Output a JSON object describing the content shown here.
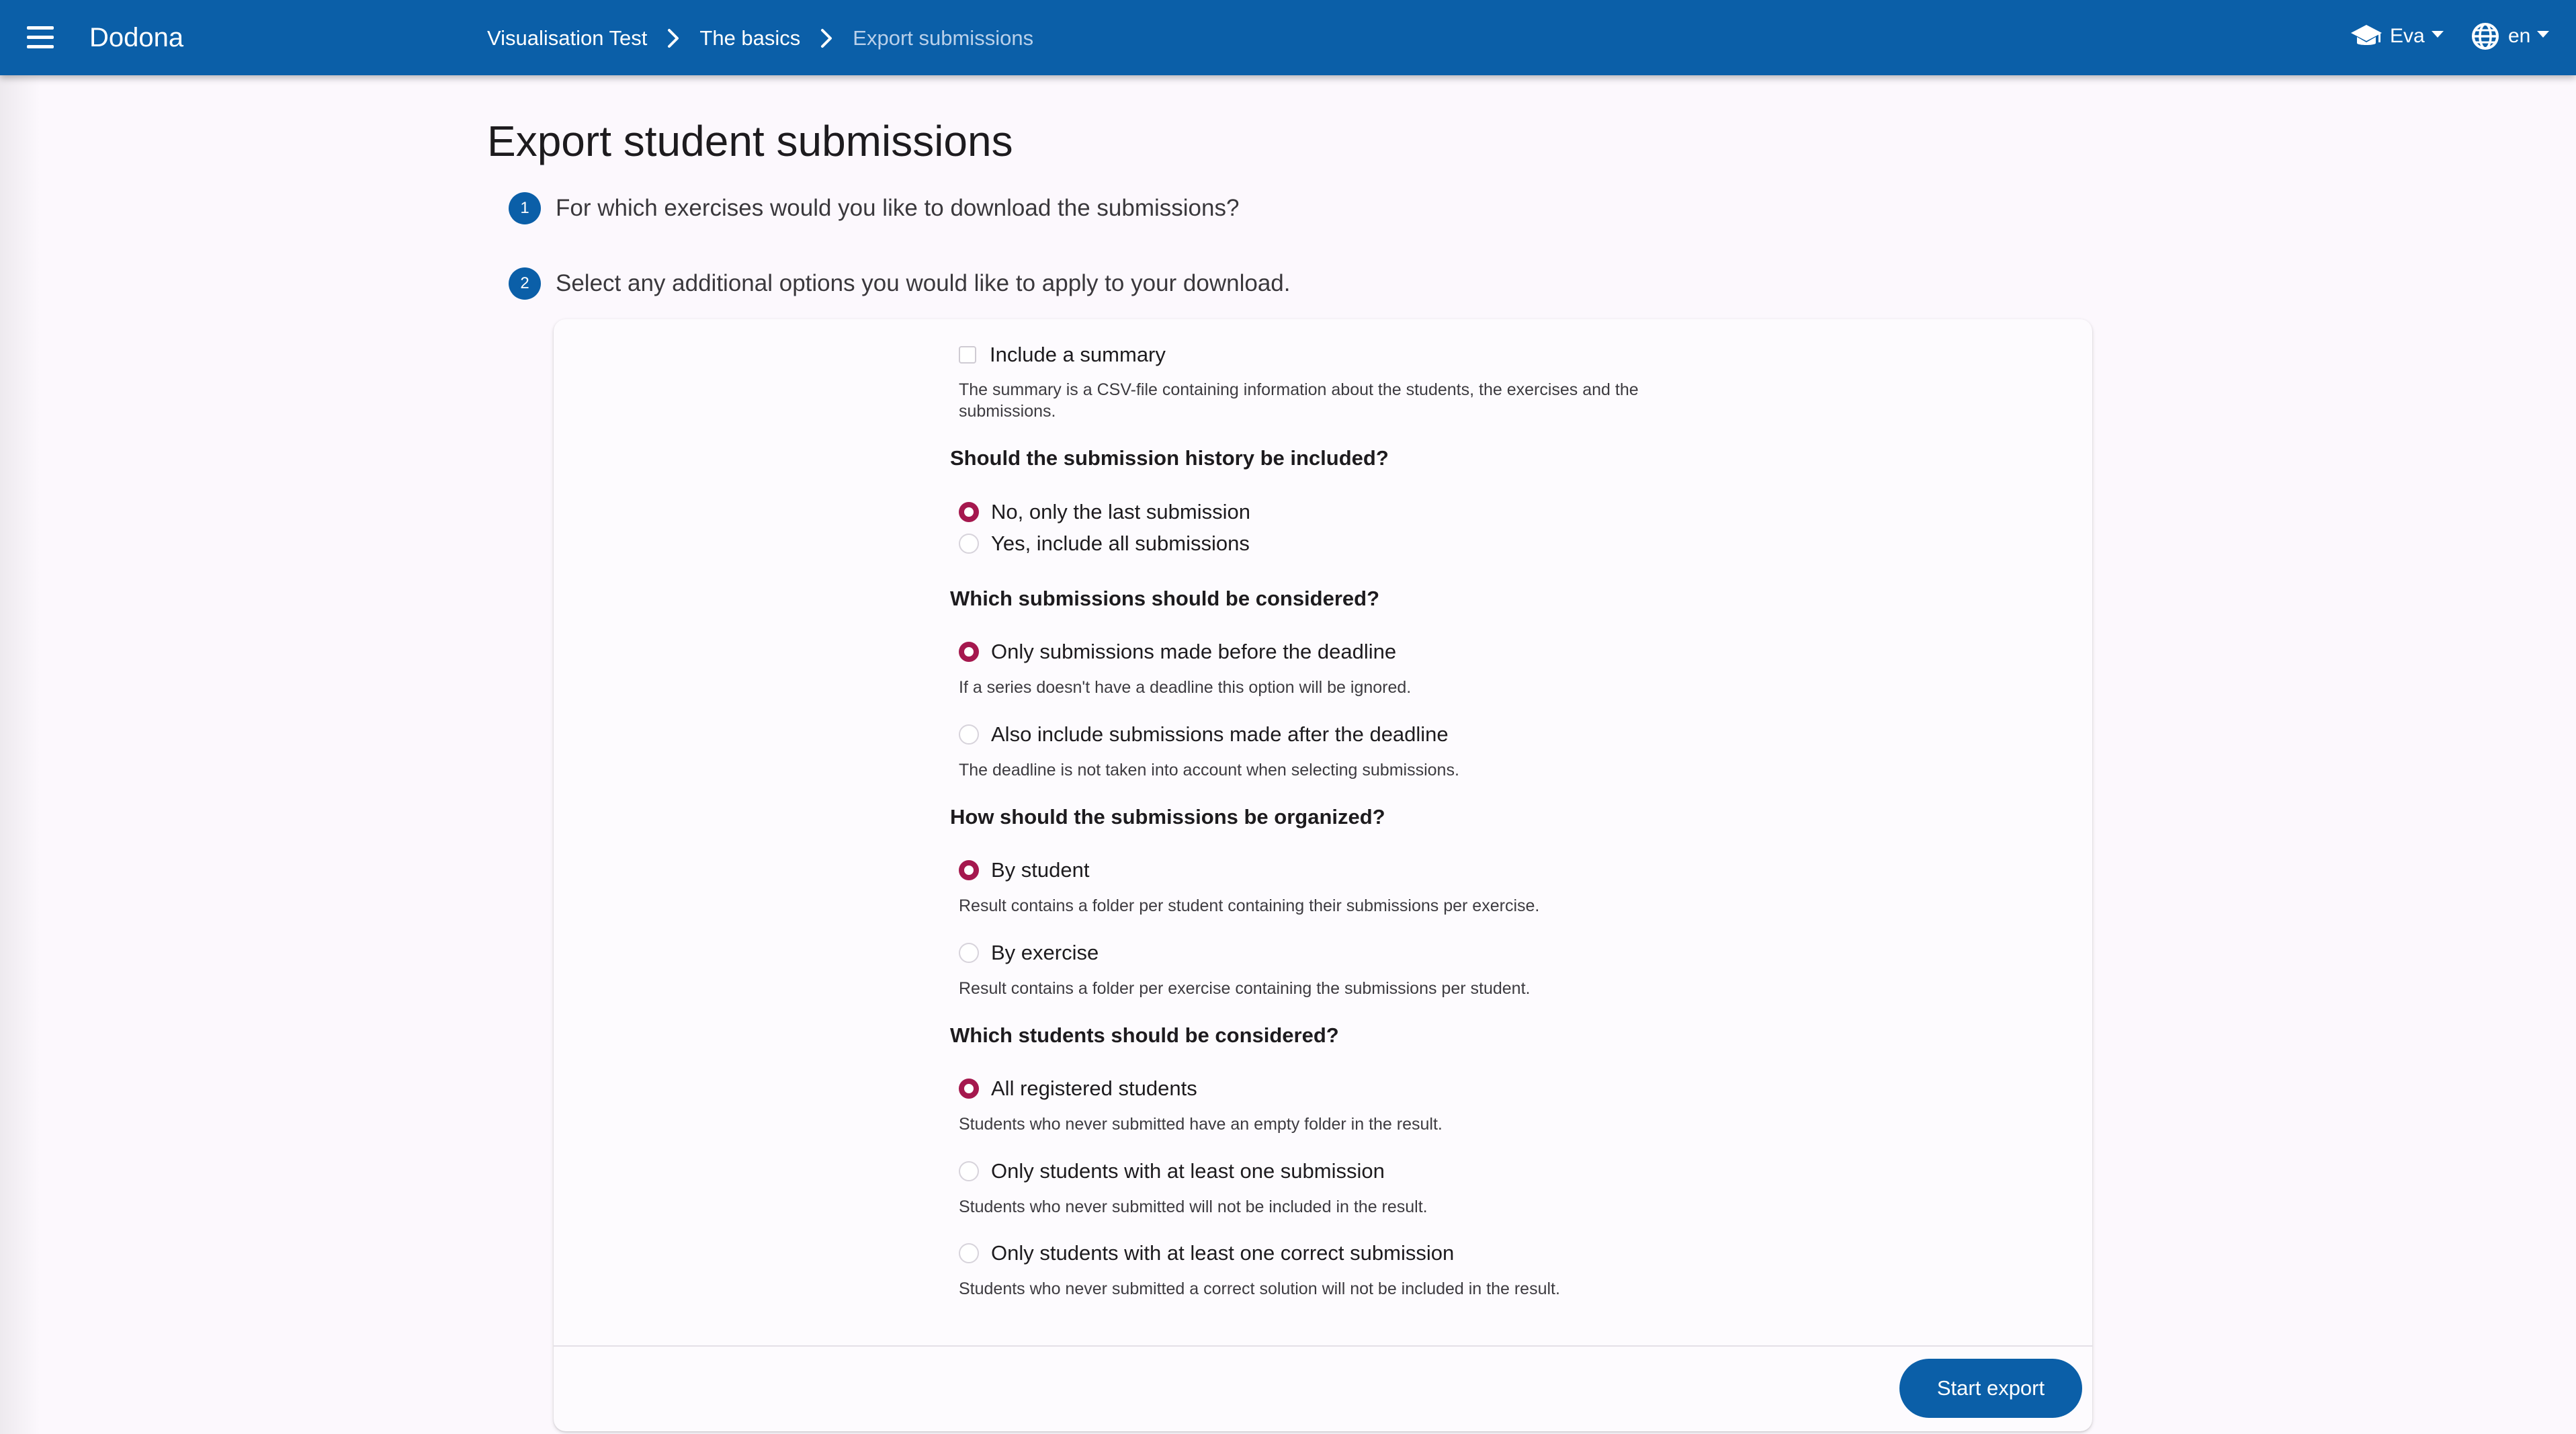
{
  "header": {
    "brand": "Dodona",
    "breadcrumbs": [
      "Visualisation Test",
      "The basics",
      "Export submissions"
    ],
    "user": "Eva",
    "language": "en"
  },
  "page": {
    "title": "Export student submissions",
    "steps": [
      {
        "number": "1",
        "text": "For which exercises would you like to download the submissions?"
      },
      {
        "number": "2",
        "text": "Select any additional options you would like to apply to your download."
      }
    ]
  },
  "options": {
    "summary": {
      "label": "Include a summary",
      "checked": false,
      "help": "The summary is a CSV-file containing information about the students, the exercises and the submissions."
    },
    "history": {
      "question": "Should the submission history be included?",
      "choices": [
        {
          "label": "No, only the last submission",
          "checked": true
        },
        {
          "label": "Yes, include all submissions",
          "checked": false
        }
      ]
    },
    "deadline": {
      "question": "Which submissions should be considered?",
      "choices": [
        {
          "label": "Only submissions made before the deadline",
          "help": "If a series doesn't have a deadline this option will be ignored.",
          "checked": true
        },
        {
          "label": "Also include submissions made after the deadline",
          "help": "The deadline is not taken into account when selecting submissions.",
          "checked": false
        }
      ]
    },
    "organize": {
      "question": "How should the submissions be organized?",
      "choices": [
        {
          "label": "By student",
          "help": "Result contains a folder per student containing their submissions per exercise.",
          "checked": true
        },
        {
          "label": "By exercise",
          "help": "Result contains a folder per exercise containing the submissions per student.",
          "checked": false
        }
      ]
    },
    "students": {
      "question": "Which students should be considered?",
      "choices": [
        {
          "label": "All registered students",
          "help": "Students who never submitted have an empty folder in the result.",
          "checked": true
        },
        {
          "label": "Only students with at least one submission",
          "help": "Students who never submitted will not be included in the result.",
          "checked": false
        },
        {
          "label": "Only students with at least one correct submission",
          "help": "Students who never submitted a correct solution will not be included in the result.",
          "checked": false
        }
      ]
    }
  },
  "actions": {
    "start_export": "Start export"
  },
  "colors": {
    "appbar": "#0b5fa8",
    "radio_checked": "#a5184e",
    "background": "#fcf8fd"
  }
}
